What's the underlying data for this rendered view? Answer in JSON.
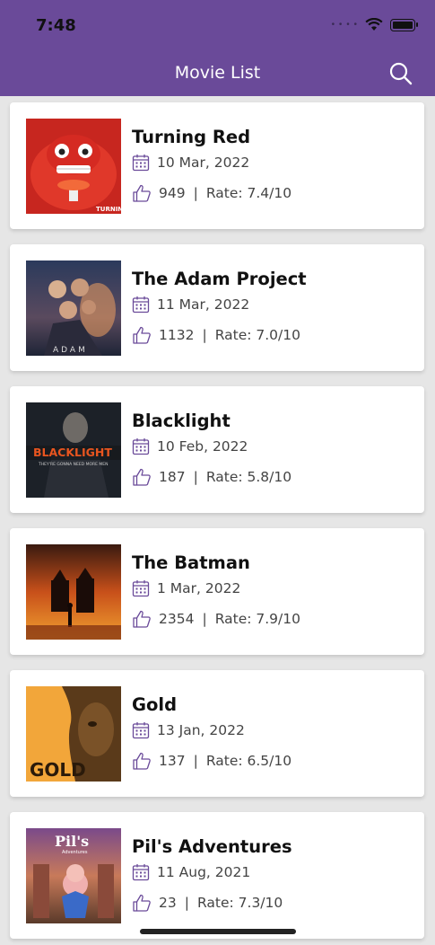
{
  "status": {
    "time": "7:48"
  },
  "header": {
    "title": "Movie List",
    "search_icon": "search-icon",
    "color": "#6a4a99"
  },
  "movies": [
    {
      "title": "Turning Red",
      "date": "10 Mar, 2022",
      "likes": "949",
      "rate": "Rate: 7.4/10"
    },
    {
      "title": "The Adam Project",
      "date": "11 Mar, 2022",
      "likes": "1132",
      "rate": "Rate: 7.0/10"
    },
    {
      "title": "Blacklight",
      "date": "10 Feb, 2022",
      "likes": "187",
      "rate": "Rate: 5.8/10"
    },
    {
      "title": "The Batman",
      "date": "1 Mar, 2022",
      "likes": "2354",
      "rate": "Rate: 7.9/10"
    },
    {
      "title": "Gold",
      "date": "13 Jan, 2022",
      "likes": "137",
      "rate": "Rate: 6.5/10"
    },
    {
      "title": "Pil's Adventures",
      "date": "11 Aug, 2021",
      "likes": "23",
      "rate": "Rate: 7.3/10"
    }
  ],
  "icons": {
    "date": "calendar-icon",
    "likes": "thumbs-up-icon"
  },
  "accent_icon_color": "#6a4a99"
}
